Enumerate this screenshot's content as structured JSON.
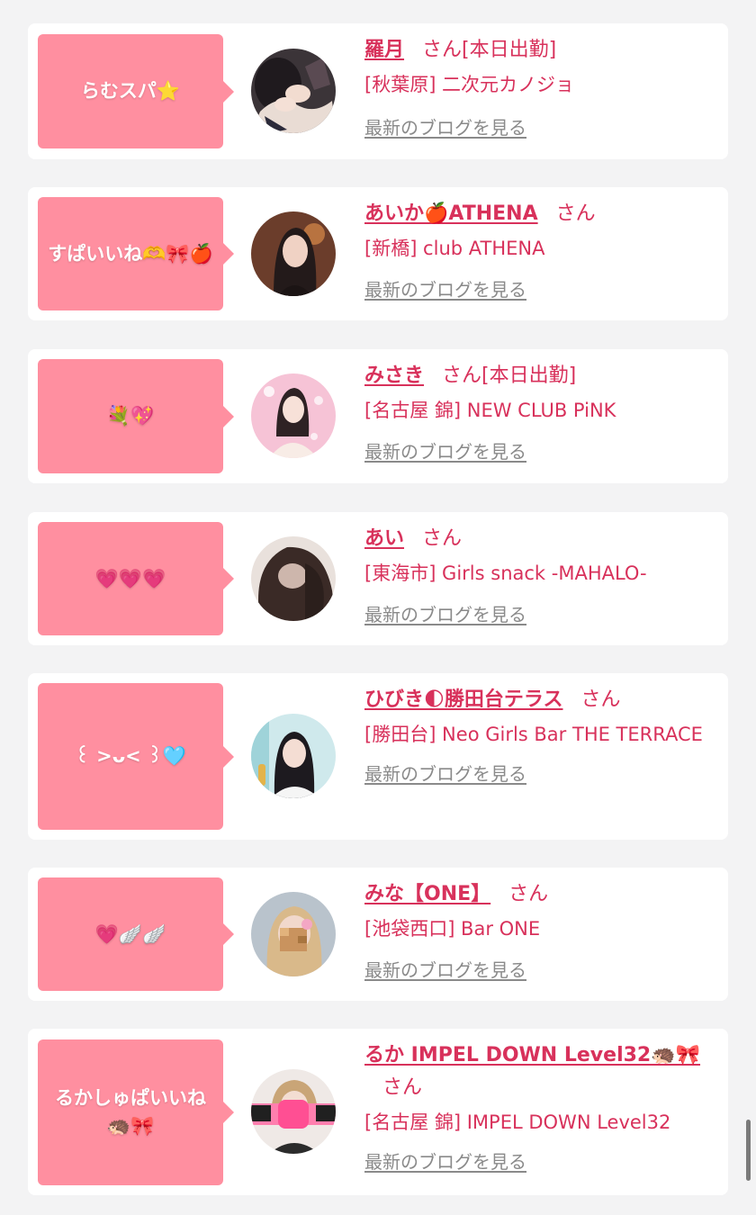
{
  "blog_link_label": "最新のブログを見る",
  "san_label": "さん",
  "entries": [
    {
      "comment": "らむスパ⭐",
      "name": "羅月",
      "status": "[本日出勤]",
      "shop": "[秋葉原] 二次元カノジョ"
    },
    {
      "comment": "すぱいいね🫶🎀🍎",
      "name": "あいか🍎ATHENA",
      "status": "",
      "shop": "[新橋] club ATHENA"
    },
    {
      "comment": "💐💖",
      "name": "みさき",
      "status": "[本日出勤]",
      "shop": "[名古屋 錦] NEW CLUB PiNK"
    },
    {
      "comment": "💗💗💗",
      "name": "あい",
      "status": "",
      "shop": "[東海市] Girls snack -MAHALO-"
    },
    {
      "comment": "꒰ >ᴗ< ꒱🩵",
      "name": "ひびき🌓勝田台テラス",
      "status": "",
      "shop": "[勝田台] Neo Girls Bar THE TERRACE"
    },
    {
      "comment": "💗🪽🪽",
      "name": "みな【ONE】",
      "status": "",
      "shop": "[池袋西口] Bar ONE"
    },
    {
      "comment": "るかしゅぱいいね🦔🎀",
      "name": "るか IMPEL DOWN Level32🦔🎀",
      "status": "",
      "shop": "[名古屋 錦] IMPEL DOWN Level32"
    }
  ]
}
